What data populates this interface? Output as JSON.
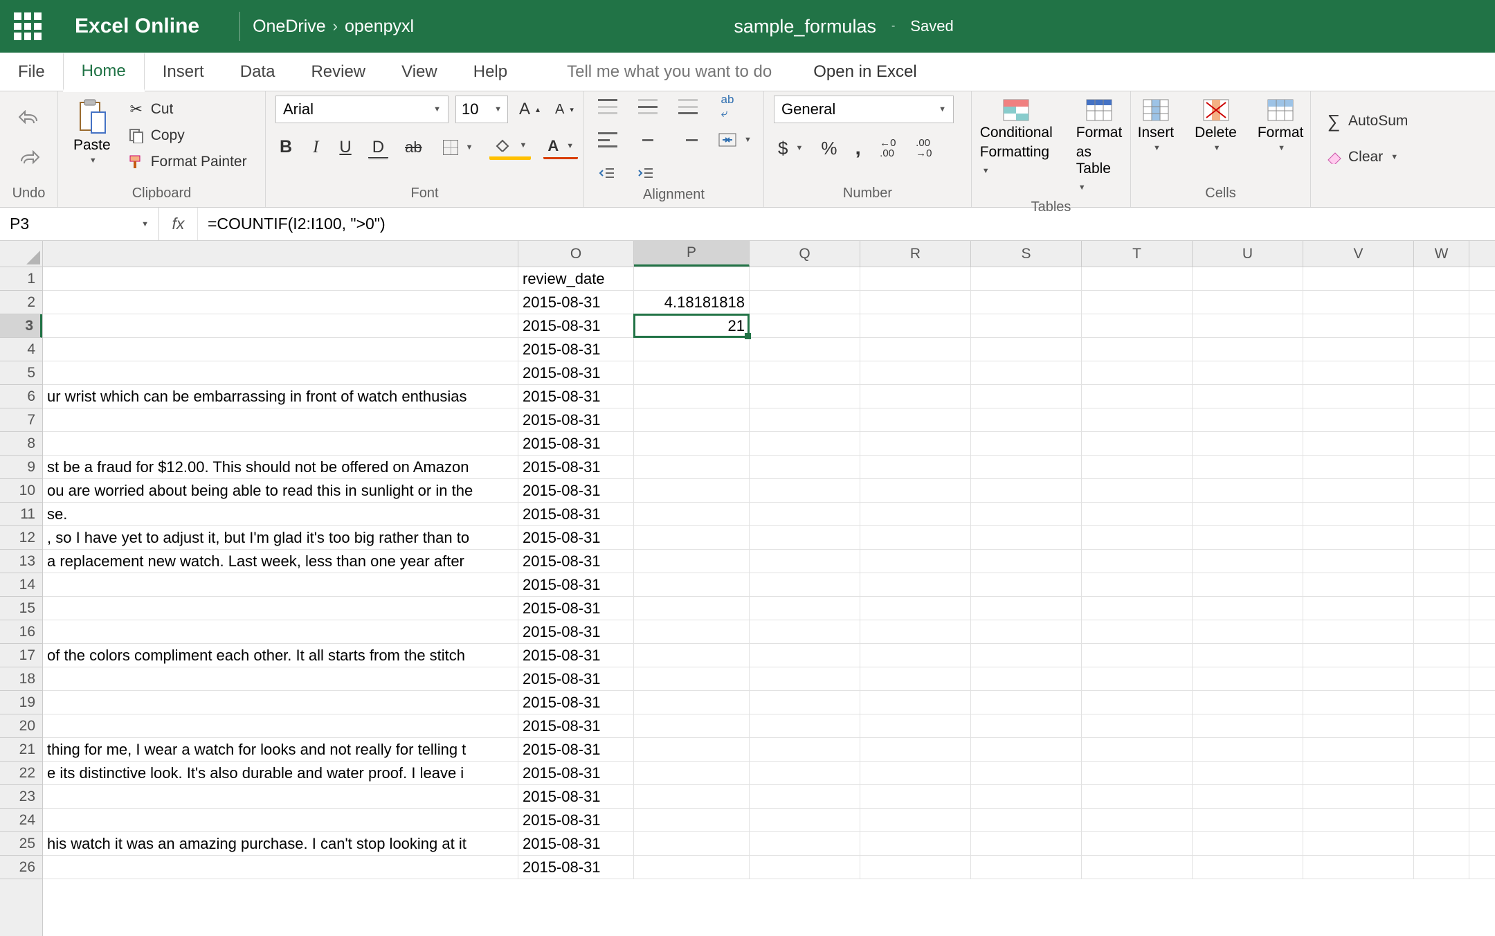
{
  "titlebar": {
    "app": "Excel Online",
    "breadcrumb": [
      "OneDrive",
      "openpyxl"
    ],
    "doc": "sample_formulas",
    "status": "Saved"
  },
  "tabs": {
    "items": [
      "File",
      "Home",
      "Insert",
      "Data",
      "Review",
      "View",
      "Help"
    ],
    "active": "Home",
    "tellme_placeholder": "Tell me what you want to do",
    "open_in": "Open in Excel"
  },
  "ribbon": {
    "undo": {
      "label": "Undo"
    },
    "clipboard": {
      "paste": "Paste",
      "cut": "Cut",
      "copy": "Copy",
      "fmtpainter": "Format Painter",
      "group": "Clipboard"
    },
    "font": {
      "name": "Arial",
      "size": "10",
      "group": "Font"
    },
    "alignment": {
      "wrap": "Wrap",
      "merge": "Merge",
      "group": "Alignment"
    },
    "number": {
      "format": "General",
      "group": "Number",
      "inc": "Increase Decimal",
      "dec": "Decrease Decimal"
    },
    "tables": {
      "cond": "Conditional",
      "cond2": "Formatting",
      "fmt": "Format",
      "fmt2": "as Table",
      "group": "Tables"
    },
    "cells": {
      "insert": "Insert",
      "delete": "Delete",
      "format": "Format",
      "group": "Cells"
    },
    "editing": {
      "autosum": "AutoSum",
      "clear": "Clear"
    }
  },
  "fxbar": {
    "cellref": "P3",
    "formula": "=COUNTIF(I2:I100, \">0\")"
  },
  "columns": [
    "O",
    "P",
    "Q",
    "R",
    "S",
    "T",
    "U",
    "V",
    "W"
  ],
  "col_widths": {
    "O": 167,
    "P": 167,
    "std": 160,
    "last": 80
  },
  "selected": {
    "col": "P",
    "row": 3
  },
  "rows": [
    {
      "n": 1,
      "before": "",
      "O": "review_date",
      "P": ""
    },
    {
      "n": 2,
      "before": "",
      "O": "2015-08-31",
      "P": "4.18181818",
      "Pnum": true
    },
    {
      "n": 3,
      "before": "",
      "O": "2015-08-31",
      "P": "21",
      "Pnum": true
    },
    {
      "n": 4,
      "before": "",
      "O": "2015-08-31",
      "P": ""
    },
    {
      "n": 5,
      "before": "",
      "O": "2015-08-31",
      "P": ""
    },
    {
      "n": 6,
      "before": "ur wrist which can be embarrassing in front of watch enthusias",
      "O": "2015-08-31",
      "P": ""
    },
    {
      "n": 7,
      "before": "",
      "O": "2015-08-31",
      "P": ""
    },
    {
      "n": 8,
      "before": "",
      "O": "2015-08-31",
      "P": ""
    },
    {
      "n": 9,
      "before": "st be a fraud for $12.00. This should not be offered on Amazon",
      "O": "2015-08-31",
      "P": ""
    },
    {
      "n": 10,
      "before": "ou are worried about being able to read this in sunlight or in the",
      "O": "2015-08-31",
      "P": ""
    },
    {
      "n": 11,
      "before": "se.",
      "O": "2015-08-31",
      "P": ""
    },
    {
      "n": 12,
      "before": ", so I have yet to adjust it, but I'm glad it's too big rather than to",
      "O": "2015-08-31",
      "P": ""
    },
    {
      "n": 13,
      "before": "a replacement new watch. Last week, less than one year after",
      "O": "2015-08-31",
      "P": ""
    },
    {
      "n": 14,
      "before": "",
      "O": "2015-08-31",
      "P": ""
    },
    {
      "n": 15,
      "before": "",
      "O": "2015-08-31",
      "P": ""
    },
    {
      "n": 16,
      "before": "",
      "O": "2015-08-31",
      "P": ""
    },
    {
      "n": 17,
      "before": "of the colors compliment each other. It all starts from the stitch",
      "O": "2015-08-31",
      "P": ""
    },
    {
      "n": 18,
      "before": "",
      "O": "2015-08-31",
      "P": ""
    },
    {
      "n": 19,
      "before": "",
      "O": "2015-08-31",
      "P": ""
    },
    {
      "n": 20,
      "before": "",
      "O": "2015-08-31",
      "P": ""
    },
    {
      "n": 21,
      "before": "thing for me, I wear a watch for looks and not really for telling t",
      "O": "2015-08-31",
      "P": ""
    },
    {
      "n": 22,
      "before": "e its distinctive look. It's also durable and water proof. I leave i",
      "O": "2015-08-31",
      "P": ""
    },
    {
      "n": 23,
      "before": "",
      "O": "2015-08-31",
      "P": ""
    },
    {
      "n": 24,
      "before": "",
      "O": "2015-08-31",
      "P": ""
    },
    {
      "n": 25,
      "before": "his watch it was an amazing purchase. I can't stop looking at it",
      "O": "2015-08-31",
      "P": ""
    },
    {
      "n": 26,
      "before": "",
      "O": "2015-08-31",
      "P": ""
    }
  ]
}
